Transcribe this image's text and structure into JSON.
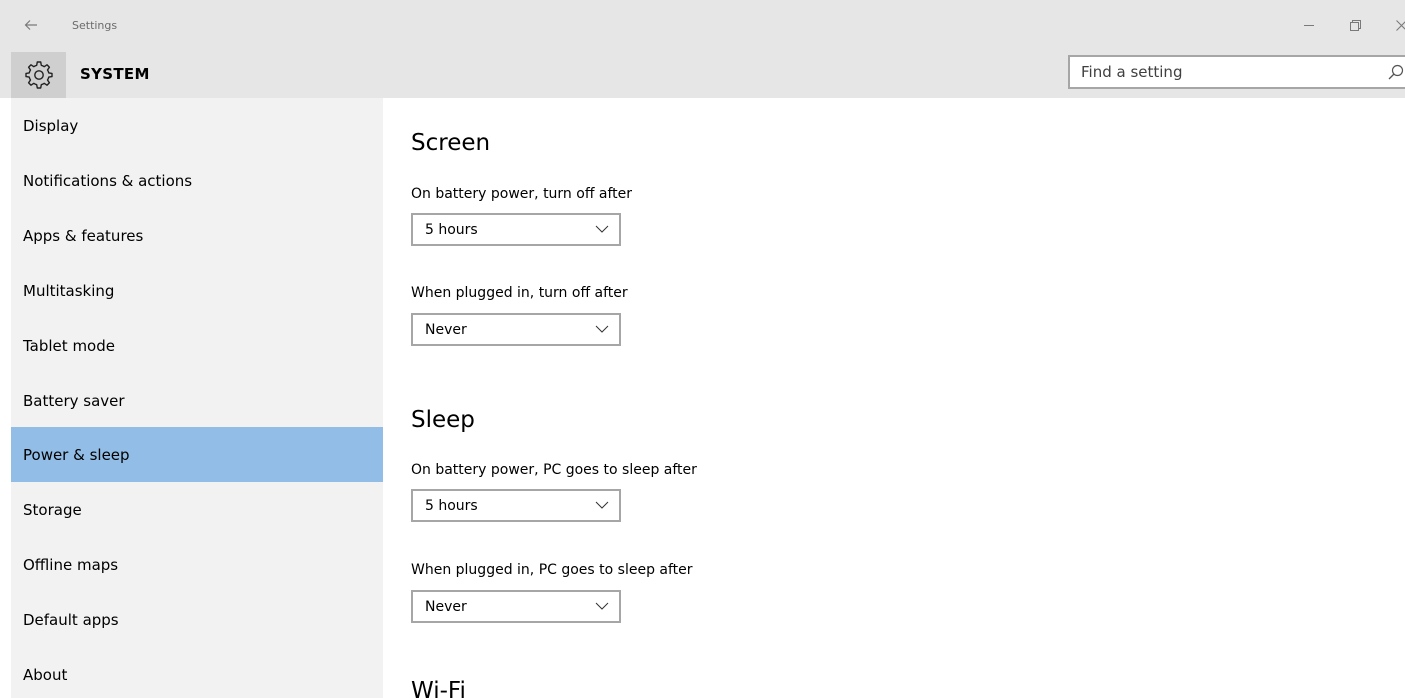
{
  "window": {
    "title": "Settings"
  },
  "header": {
    "title": "SYSTEM",
    "search_placeholder": "Find a setting"
  },
  "sidebar": {
    "items": [
      {
        "label": "Display"
      },
      {
        "label": "Notifications & actions"
      },
      {
        "label": "Apps & features"
      },
      {
        "label": "Multitasking"
      },
      {
        "label": "Tablet mode"
      },
      {
        "label": "Battery saver"
      },
      {
        "label": "Power & sleep"
      },
      {
        "label": "Storage"
      },
      {
        "label": "Offline maps"
      },
      {
        "label": "Default apps"
      },
      {
        "label": "About"
      }
    ],
    "selected_item": "Power & sleep"
  },
  "content": {
    "screen": {
      "title": "Screen",
      "battery_label": "On battery power, turn off after",
      "battery_value": "5 hours",
      "plugged_label": "When plugged in, turn off after",
      "plugged_value": "Never"
    },
    "sleep": {
      "title": "Sleep",
      "battery_label": "On battery power, PC goes to sleep after",
      "battery_value": "5 hours",
      "plugged_label": "When plugged in, PC goes to sleep after",
      "plugged_value": "Never"
    },
    "wifi": {
      "title": "Wi-Fi"
    }
  },
  "icons": {
    "back": "back-arrow-icon",
    "header": "gear-icon",
    "search": "search-icon",
    "dropdown": "chevron-down-icon"
  },
  "colors": {
    "chrome_background": "#e6e6e6",
    "sidebar_background": "#f2f2f2",
    "selected_item": "#91bde6",
    "control_border": "#a6a6a6"
  }
}
